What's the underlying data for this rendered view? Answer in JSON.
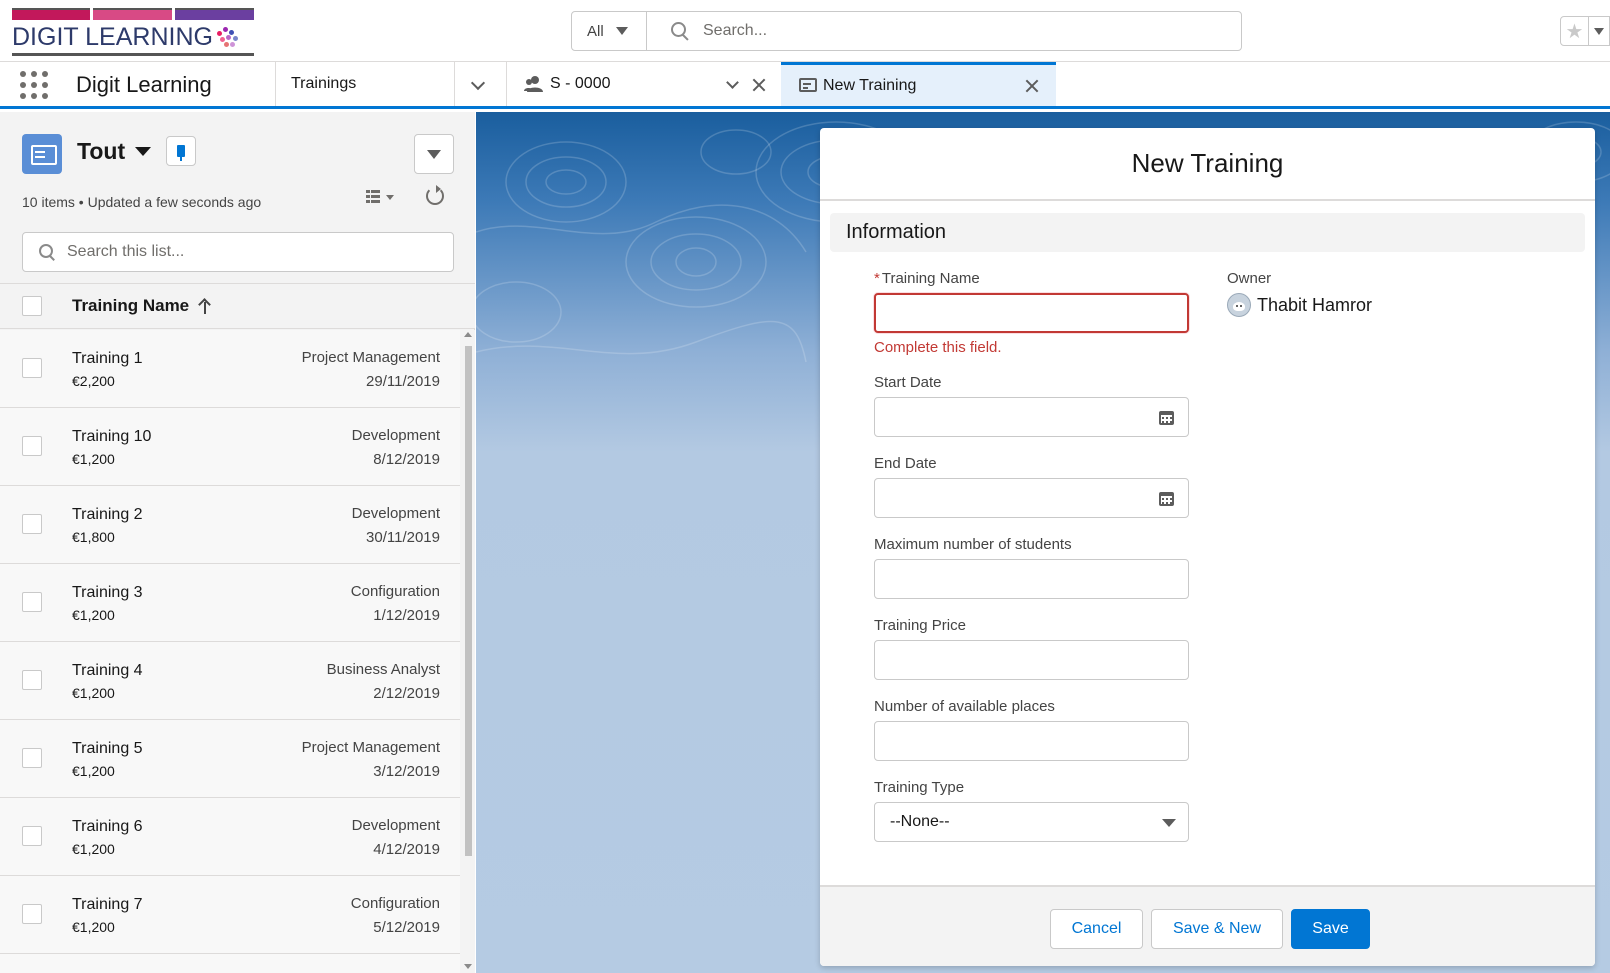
{
  "header": {
    "logo_text": "DIGIT LEARNING",
    "search_scope": "All",
    "search_placeholder": "Search..."
  },
  "nav": {
    "app_name": "Digit Learning",
    "object_tab": "Trainings",
    "tabs": [
      {
        "label": "S - 0000",
        "icon": "contact-icon"
      },
      {
        "label": "New Training",
        "icon": "training-icon",
        "active": true
      }
    ]
  },
  "list": {
    "view_name": "Tout",
    "meta": "10 items • Updated a few seconds ago",
    "search_placeholder": "Search this list...",
    "column_header": "Training Name",
    "rows": [
      {
        "name": "Training 1",
        "price": "€2,200",
        "type": "Project Management",
        "date": "29/11/2019"
      },
      {
        "name": "Training 10",
        "price": "€1,200",
        "type": "Development",
        "date": "8/12/2019"
      },
      {
        "name": "Training 2",
        "price": "€1,800",
        "type": "Development",
        "date": "30/11/2019"
      },
      {
        "name": "Training 3",
        "price": "€1,200",
        "type": "Configuration",
        "date": "1/12/2019"
      },
      {
        "name": "Training 4",
        "price": "€1,200",
        "type": "Business Analyst",
        "date": "2/12/2019"
      },
      {
        "name": "Training 5",
        "price": "€1,200",
        "type": "Project Management",
        "date": "3/12/2019"
      },
      {
        "name": "Training 6",
        "price": "€1,200",
        "type": "Development",
        "date": "4/12/2019"
      },
      {
        "name": "Training 7",
        "price": "€1,200",
        "type": "Configuration",
        "date": "5/12/2019"
      }
    ]
  },
  "modal": {
    "title": "New Training",
    "section": "Information",
    "fields": {
      "training_name": {
        "label": "Training Name",
        "required": "*",
        "value": "",
        "error": "Complete this field."
      },
      "start_date": {
        "label": "Start Date",
        "value": ""
      },
      "end_date": {
        "label": "End Date",
        "value": ""
      },
      "max_students": {
        "label": "Maximum number of students",
        "value": ""
      },
      "price": {
        "label": "Training Price",
        "value": ""
      },
      "available_places": {
        "label": "Number of available places",
        "value": ""
      },
      "training_type": {
        "label": "Training Type",
        "value": "--None--"
      }
    },
    "owner": {
      "label": "Owner",
      "name": "Thabit Hamror"
    },
    "buttons": {
      "cancel": "Cancel",
      "save_new": "Save & New",
      "save": "Save"
    }
  },
  "colors": {
    "brand_blue": "#0176d3",
    "error_red": "#c23934",
    "logo_bar_1": "#c2185b",
    "logo_bar_2": "#d84a85",
    "logo_bar_3": "#6b3fa0",
    "logo_text": "#2d3a6a"
  }
}
